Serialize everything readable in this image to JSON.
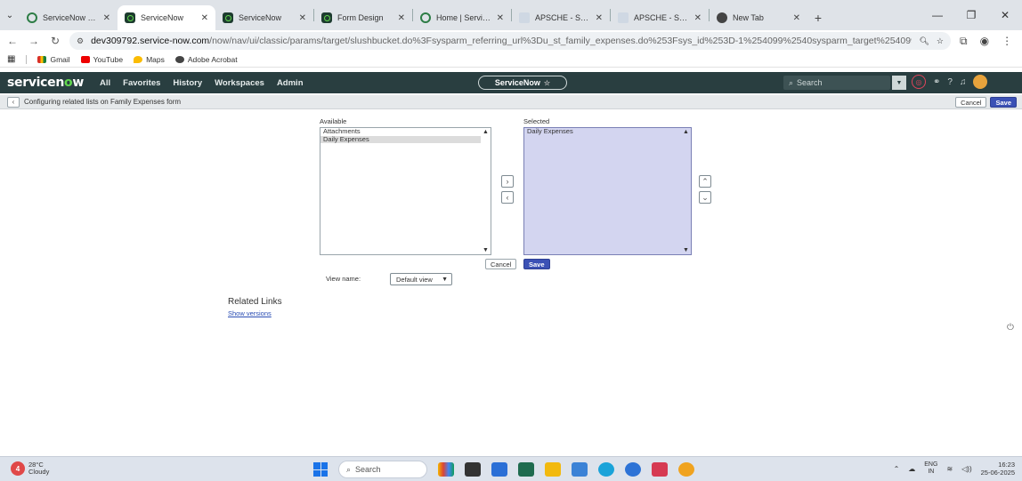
{
  "browser": {
    "tabs": [
      {
        "title": "ServiceNow Deve",
        "icon": "servicenow-ring-icon",
        "active": false
      },
      {
        "title": "ServiceNow",
        "icon": "servicenow-icon",
        "active": true
      },
      {
        "title": "ServiceNow",
        "icon": "servicenow-icon",
        "active": false
      },
      {
        "title": "Form Design",
        "icon": "servicenow-icon",
        "active": false
      },
      {
        "title": "Home | ServiceN",
        "icon": "servicenow-ring-icon",
        "active": false
      },
      {
        "title": "APSCHE - Smartl",
        "icon": "apsche-icon",
        "active": false
      },
      {
        "title": "APSCHE - Smartl",
        "icon": "apsche-icon",
        "active": false
      },
      {
        "title": "New Tab",
        "icon": "chrome-icon",
        "active": false
      }
    ],
    "url_host": "dev309792.service-now.com",
    "url_path": "/now/nav/ui/classic/params/target/slushbucket.do%3Fsysparm_referring_url%3Du_st_family_expenses.do%253Fsys_id%253D-1%254099%2540sysparm_target%254099%...",
    "bookmarks": [
      "Gmail",
      "YouTube",
      "Maps",
      "Adobe Acrobat"
    ]
  },
  "sn_header": {
    "logo_pre": "servicen",
    "logo_o": "o",
    "logo_post": "w",
    "menu": [
      "All",
      "Favorites",
      "History",
      "Workspaces",
      "Admin"
    ],
    "scope_pill": "ServiceNow",
    "search_placeholder": "Search"
  },
  "form": {
    "title": "Configuring related lists on Family Expenses form",
    "cancel_label": "Cancel",
    "save_label": "Save"
  },
  "slushbucket": {
    "available_label": "Available",
    "selected_label": "Selected",
    "available_items": [
      "Attachments",
      "Daily Expenses"
    ],
    "selected_items": [
      "Daily Expenses"
    ],
    "cancel_label": "Cancel",
    "save_label": "Save",
    "view_label": "View name:",
    "view_value": "Default view"
  },
  "related_links": {
    "title": "Related Links",
    "link": "Show versions"
  },
  "taskbar": {
    "temp": "28°C",
    "condition": "Cloudy",
    "weather_badge": "4",
    "search_placeholder": "Search",
    "lang_top": "ENG",
    "lang_bottom": "IN",
    "time": "16:23",
    "date": "25-06-2025"
  },
  "colors": {
    "sn_header_bg": "#293e40",
    "sn_accent": "#62d84e",
    "save_button": "#3b51b5",
    "selected_list_bg": "#d3d5f0"
  }
}
